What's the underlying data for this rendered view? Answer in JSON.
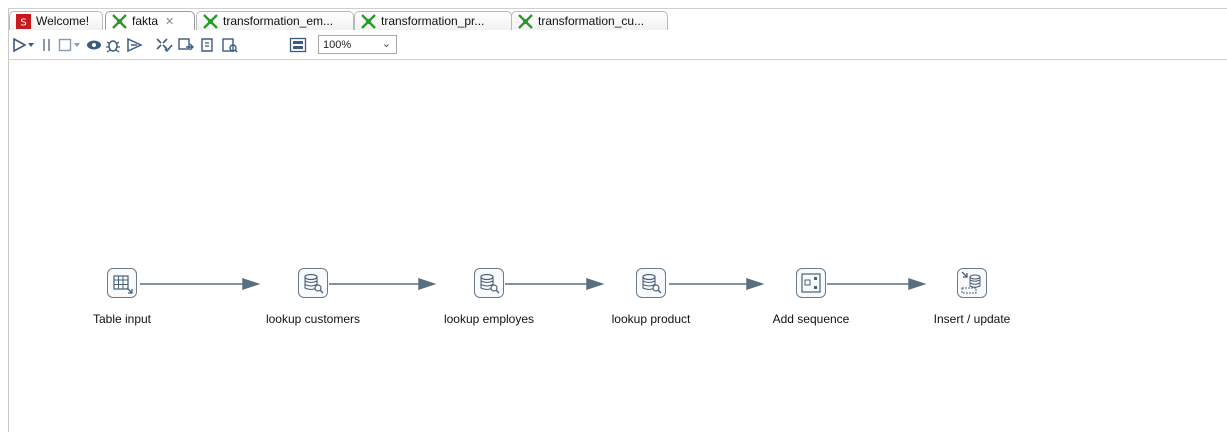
{
  "tabs": [
    {
      "label": "Welcome!",
      "icon": "pentaho-welcome-icon",
      "active": false
    },
    {
      "label": "fakta",
      "icon": "transformation-icon",
      "active": true,
      "close": "✕"
    },
    {
      "label": "transformation_em...",
      "icon": "transformation-icon",
      "active": false
    },
    {
      "label": "transformation_pr...",
      "icon": "transformation-icon",
      "active": false
    },
    {
      "label": "transformation_cu...",
      "icon": "transformation-icon",
      "active": false
    }
  ],
  "toolbar": {
    "icons": [
      "run-icon",
      "run-dropdown-icon",
      "pause-icon",
      "stop-icon",
      "stop-dropdown-icon",
      "preview-icon",
      "debug-icon",
      "replay-icon",
      "verify-icon",
      "impact-icon",
      "sql-icon",
      "explore-db-icon",
      "show-results-icon"
    ],
    "zoom_value": "100%"
  },
  "steps": [
    {
      "label": "Table input",
      "icon": "table-input-icon"
    },
    {
      "label": "lookup customers",
      "icon": "database-lookup-icon"
    },
    {
      "label": "lookup employes",
      "icon": "database-lookup-icon"
    },
    {
      "label": "lookup product",
      "icon": "database-lookup-icon"
    },
    {
      "label": "Add sequence",
      "icon": "add-sequence-icon"
    },
    {
      "label": "Insert / update",
      "icon": "insert-update-icon"
    }
  ],
  "colors": {
    "transformation_green": "#2e9a2e",
    "hop_line": "#5a6e82",
    "step_border": "#6a7a8a",
    "welcome_red": "#c8191e"
  }
}
